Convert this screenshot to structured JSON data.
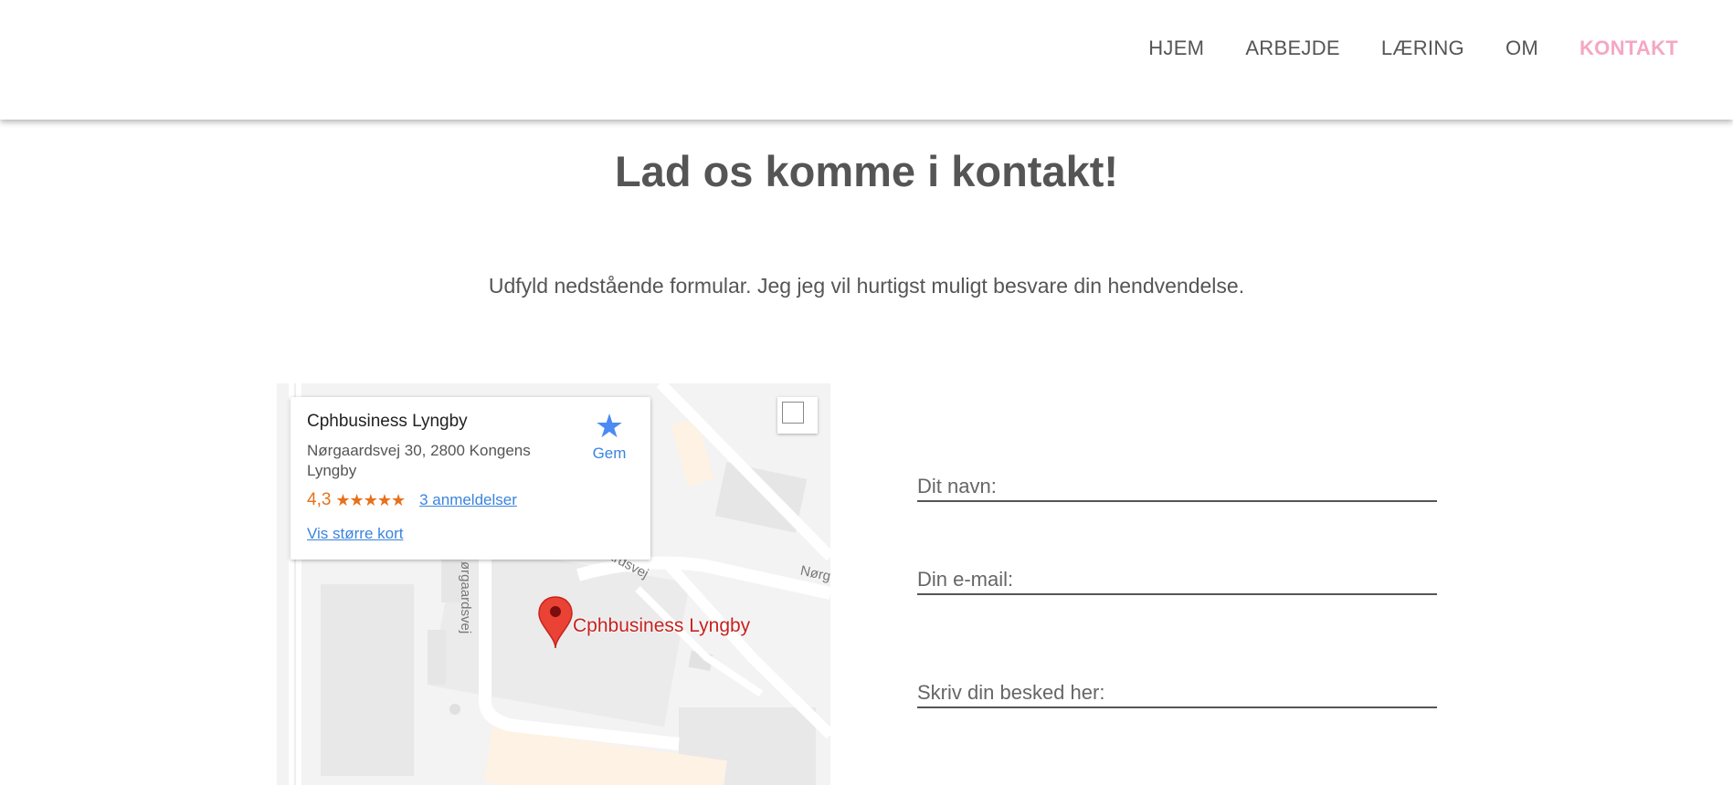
{
  "nav": {
    "items": [
      {
        "label": "HJEM"
      },
      {
        "label": "ARBEJDE"
      },
      {
        "label": "LÆRING"
      },
      {
        "label": "OM"
      },
      {
        "label": "KONTAKT"
      }
    ],
    "active": "KONTAKT",
    "active_color": "#f4a7c4"
  },
  "main": {
    "title": "Lad os komme i kontakt!",
    "intro": "Udfyld nedstående formular. Jeg jeg vil hurtigst muligt besvare din hendvendelse."
  },
  "map": {
    "place_name": "Cphbusiness Lyngby",
    "address": "Nørgaardsvej 30, 2800 Kongens Lyngby",
    "rating": "4,3",
    "rating_value": 4.3,
    "stars": "★★★★★",
    "reviews": "3 anmeldelser",
    "larger_map": "Vis større kort",
    "save_label": "Gem",
    "pin_label": "Cphbusiness Lyngby",
    "street_1": "ørgaardsvej",
    "street_2": "ardsvej",
    "street_3": "Nørg",
    "icons": {
      "save": "star-icon",
      "pin": "map-pin-icon"
    }
  },
  "form": {
    "name_placeholder": "Dit navn:",
    "email_placeholder": "Din e-mail:",
    "message_placeholder": "Skriv din besked her:"
  }
}
